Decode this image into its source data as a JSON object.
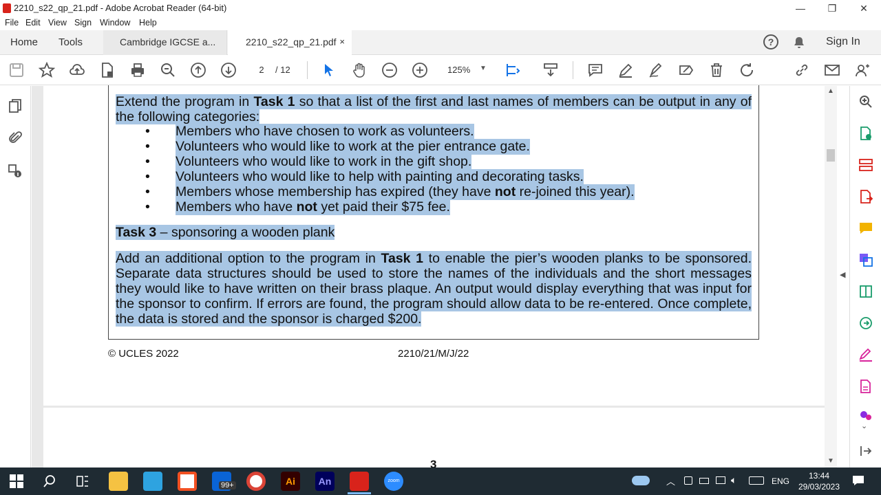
{
  "window": {
    "title": "2210_s22_qp_21.pdf - Adobe Acrobat Reader (64-bit)",
    "min": "—",
    "max": "❐",
    "close": "✕"
  },
  "menu": [
    "File",
    "Edit",
    "View",
    "Sign",
    "Window",
    "Help"
  ],
  "tabs": {
    "home": "Home",
    "tools": "Tools",
    "doc1": "Cambridge IGCSE a...",
    "doc2": "2210_s22_qp_21.pdf",
    "close": "×",
    "signin": "Sign In"
  },
  "toolbar": {
    "page": "2",
    "total": "/ 12",
    "zoom": "125%"
  },
  "doc": {
    "p1a": "Extend the program in ",
    "p1b": "Task 1",
    "p1c": " so that a list of the first and last names of members can be output in any of the following categories:",
    "bullet": "•",
    "b1": "Members who have chosen to work as volunteers.",
    "b2": "Volunteers who would like to work at the pier entrance gate.",
    "b3": "Volunteers who would like to work in the gift shop.",
    "b4": "Volunteers who would like to help with painting and decorating tasks.",
    "b5a": "Members whose membership has expired (they have ",
    "b5b": "not",
    "b5c": " re-joined this year).",
    "b6a": "Members who have ",
    "b6b": "not",
    "b6c": " yet paid their $75 fee.",
    "t3a": "Task 3",
    "t3b": " – sponsoring a wooden plank",
    "p2a": "Add an additional option to the program in ",
    "p2b": "Task 1",
    "p2c": " to enable the pier’s wooden planks to be sponsored. Separate data structures should be used to store the names of the individuals and the short messages they would like to have written on their brass plaque. An output would display everything that was input for the sponsor to confirm. If errors are found, the program should allow data to be re-entered. Once complete, the data is stored and the sponsor is charged $200.",
    "footer_left": "© UCLES 2022",
    "footer_mid": "2210/21/M/J/22",
    "next_page": "3"
  },
  "taskbar": {
    "mail_badge": "99+",
    "ai": "Ai",
    "an": "An",
    "zoom": "zoom",
    "lang": "ENG",
    "time": "13:44",
    "date": "29/03/2023"
  },
  "colors": {
    "highlight": "#a8c6e4",
    "acrobat_red": "#d8231b",
    "taskbar": "#1f2b33",
    "accent": "#1473e6"
  }
}
